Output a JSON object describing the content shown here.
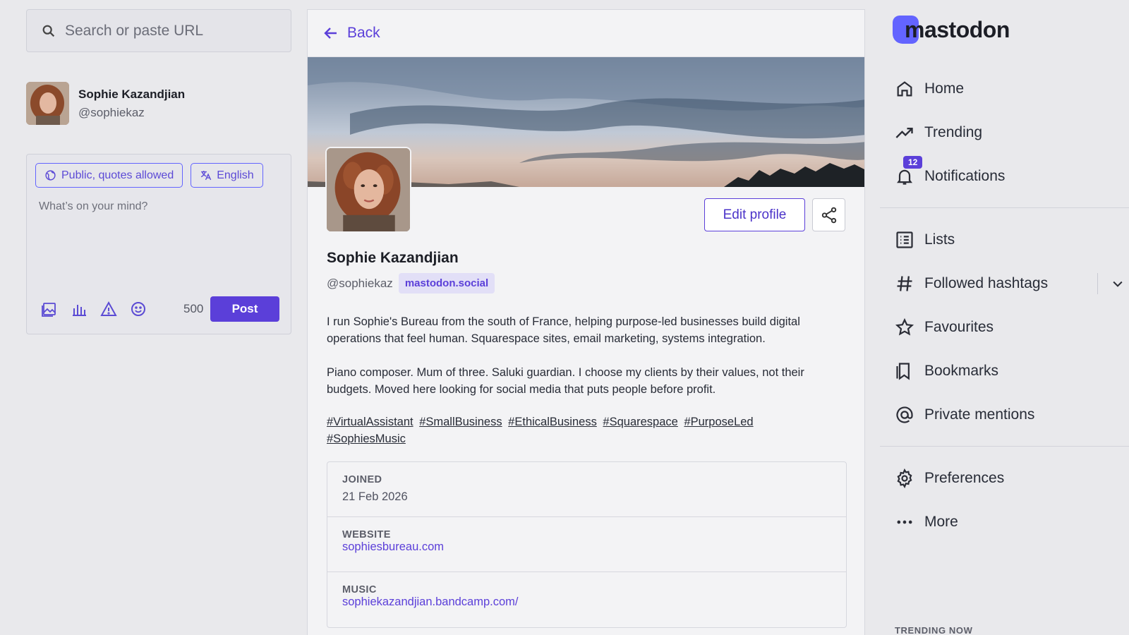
{
  "search": {
    "placeholder": "Search or paste URL"
  },
  "account": {
    "name": "Sophie Kazandjian",
    "handle": "@sophiekaz"
  },
  "composer": {
    "visibility_label": "Public, quotes allowed",
    "language_label": "English",
    "placeholder": "What’s on your mind?",
    "char_count": "500",
    "post_label": "Post",
    "icons": [
      "media-icon",
      "poll-icon",
      "warning-icon",
      "emoji-icon"
    ]
  },
  "profile": {
    "back_label": "Back",
    "name": "Sophie Kazandjian",
    "handle": "@sophiekaz",
    "domain": "mastodon.social",
    "edit_label": "Edit profile",
    "bio": [
      "I run Sophie's Bureau from the south of France, helping purpose-led businesses build digital operations that feel human. Squarespace sites, email marketing, systems integration.",
      "Piano composer. Mum of three. Saluki guardian. I choose my clients by their values, not their budgets. Moved here looking for social media that puts people before profit."
    ],
    "hashtags": [
      "#VirtualAssistant",
      "#SmallBusiness",
      "#EthicalBusiness",
      "#Squarespace",
      "#PurposeLed",
      "#SophiesMusic"
    ],
    "fields": [
      {
        "label": "JOINED",
        "value": "21 Feb 2026"
      },
      {
        "label": "WEBSITE",
        "value": "sophiesbureau.com"
      },
      {
        "label": "MUSIC",
        "value": "sophiekazandjian.bandcamp.com/"
      }
    ]
  },
  "nav": {
    "logo_text": "mastodon",
    "items": [
      {
        "label": "Home",
        "icon": "home-icon"
      },
      {
        "label": "Trending",
        "icon": "trending-icon"
      },
      {
        "label": "Notifications",
        "icon": "bell-icon",
        "badge": "12"
      },
      {
        "label": "Lists",
        "icon": "list-icon"
      },
      {
        "label": "Followed hashtags",
        "icon": "hashtag-icon"
      },
      {
        "label": "Favourites",
        "icon": "star-icon"
      },
      {
        "label": "Bookmarks",
        "icon": "bookmark-icon"
      },
      {
        "label": "Private mentions",
        "icon": "at-icon"
      },
      {
        "label": "Preferences",
        "icon": "gear-icon"
      },
      {
        "label": "More",
        "icon": "more-icon"
      }
    ],
    "trending_heading": "TRENDING NOW"
  },
  "colors": {
    "accent": "#5b3fd9",
    "brand": "#6364ff",
    "background": "#e9e9ec"
  }
}
